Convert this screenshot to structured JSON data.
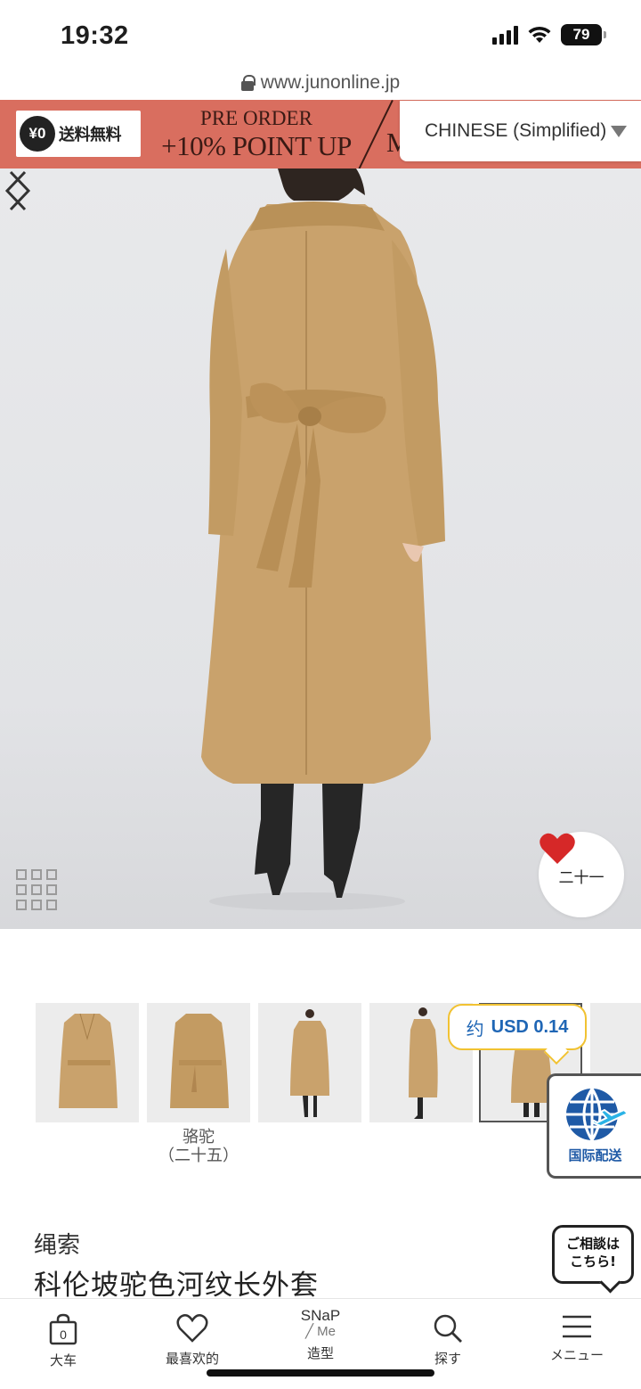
{
  "status_bar": {
    "time": "19:32",
    "battery": "79"
  },
  "browser": {
    "url": "www.junonline.jp"
  },
  "promo": {
    "shipping_yen": "¥0",
    "shipping_text": "送料無料",
    "preorder_line1": "PRE ORDER",
    "preorder_line2": "+10% POINT UP",
    "cut_text": "M"
  },
  "language": {
    "selected": "CHINESE (Simplified)"
  },
  "product_image": {
    "favorite_count": "二十一"
  },
  "thumbnails": [
    {
      "label": ""
    },
    {
      "label": "骆驼\n（二十五）"
    },
    {
      "label": ""
    },
    {
      "label": ""
    },
    {
      "label": ""
    }
  ],
  "thumbnail_color": {
    "name": "骆驼",
    "count": "（二十五）"
  },
  "price_popup": {
    "prefix": "约",
    "amount": "USD 0.14"
  },
  "intl_shipping": {
    "label": "国际配送"
  },
  "product": {
    "brand": "绳索",
    "name": "科伦坡驼色河纹长外套"
  },
  "consult": {
    "line1": "ご相談は",
    "line2": "こちら!"
  },
  "bottom_nav": [
    {
      "label": "大车",
      "badge": "0",
      "icon": "bag-icon"
    },
    {
      "label": "最喜欢的",
      "icon": "heart-icon"
    },
    {
      "label": "造型",
      "logo_top": "SNaP",
      "logo_bottom": "╱ Me",
      "icon": "snap-logo"
    },
    {
      "label": "探す",
      "icon": "search-icon"
    },
    {
      "label": "メニュー",
      "icon": "menu-icon"
    }
  ],
  "colors": {
    "banner": "#d96e5f",
    "coat": "#c9a26c",
    "heart": "#d62828",
    "price_text": "#1f66b5",
    "price_border": "#f1c232"
  }
}
